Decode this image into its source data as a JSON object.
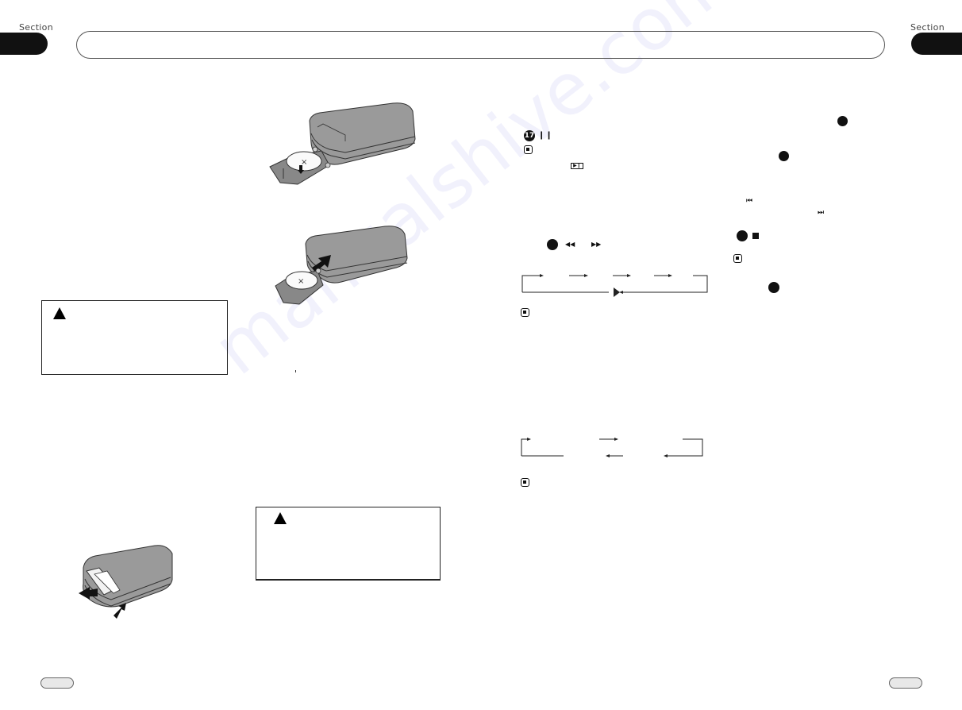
{
  "header": {
    "left_section_label": "Section",
    "right_section_label": "Section",
    "left_section_number": "",
    "right_section_number": "",
    "title": ""
  },
  "footer": {
    "left_page_number": "",
    "right_page_number": ""
  },
  "left_page": {
    "warning_box": {
      "icon": "warning-triangle-icon",
      "text": ""
    },
    "illustration": {
      "name": "remote-battery-tray-removal",
      "description": "Remote control with battery tray being pulled out; arrows indicate press and pull"
    }
  },
  "middle_column": {
    "illustrations": [
      {
        "name": "remote-battery-insert",
        "description": "Coin battery placed into tray with downward arrow"
      },
      {
        "name": "remote-tray-reinsert",
        "description": "Battery tray pushed back into remote with arrow"
      }
    ],
    "warning_box": {
      "icon": "warning-triangle-icon",
      "text": ""
    }
  },
  "right_page": {
    "pause_item": {
      "number": "17",
      "glyph": "❙❙"
    },
    "play_pause_glyph": "▶❙",
    "fast_search": {
      "rewind_glyph": "◀◀",
      "forward_glyph": "▶▶"
    },
    "play_glyph": "▶",
    "skip": {
      "previous_glyph": "⏮",
      "next_glyph": "⏭"
    },
    "stop": {
      "glyph": "■"
    }
  },
  "watermark": "manualshive.com",
  "colors": {
    "ink": "#111111",
    "device_gray": "#9a9a9a",
    "watermark": "#8c8ce6"
  }
}
